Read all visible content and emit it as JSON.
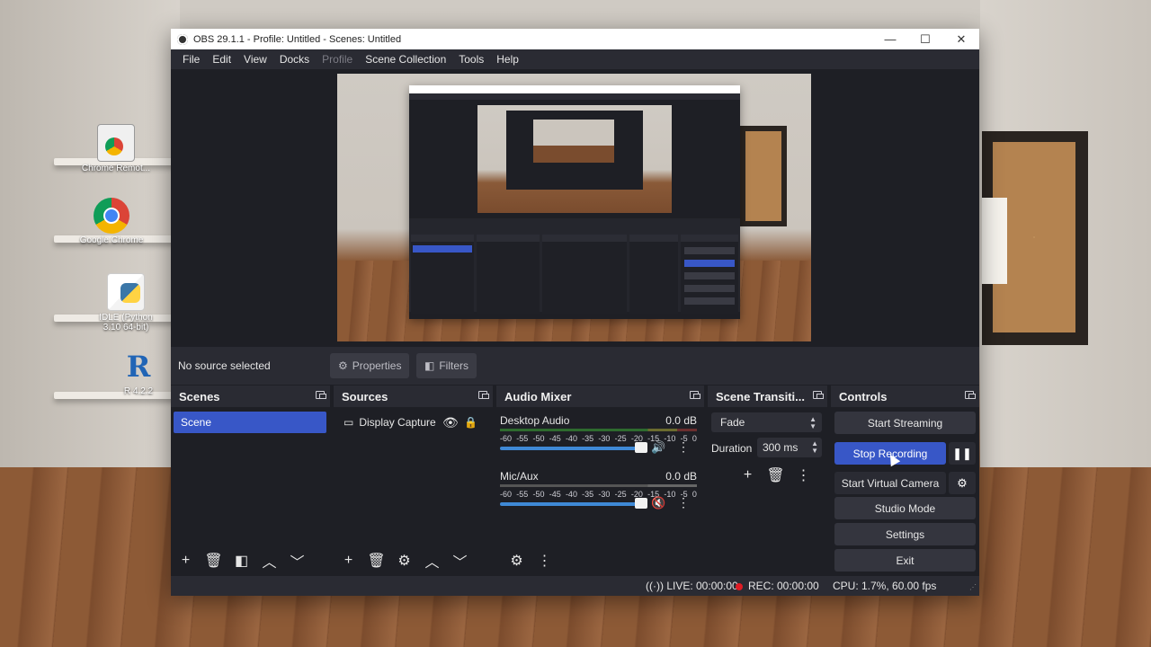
{
  "desktop": {
    "icons": [
      {
        "label": "Chrome Remot...",
        "icon": "chrome-remote-desktop-icon"
      },
      {
        "label": "Google Chrome",
        "icon": "chrome-icon"
      },
      {
        "label": "IDLE (Python 3.10 64-bit)",
        "icon": "python-idle-icon"
      },
      {
        "label": "R 4.2.2",
        "icon": "r-icon"
      }
    ]
  },
  "window": {
    "title": "OBS 29.1.1 - Profile: Untitled - Scenes: Untitled",
    "controls": {
      "minimize": "—",
      "maximize": "☐",
      "close": "✕"
    }
  },
  "menu": {
    "items": [
      "File",
      "Edit",
      "View",
      "Docks",
      "Profile",
      "Scene Collection",
      "Tools",
      "Help"
    ],
    "disabled": [
      "Profile"
    ]
  },
  "source_toolbar": {
    "status": "No source selected",
    "properties": "Properties",
    "filters": "Filters"
  },
  "docks": {
    "scenes": {
      "title": "Scenes",
      "items": [
        "Scene"
      ],
      "selected": "Scene"
    },
    "sources": {
      "title": "Sources",
      "items": [
        {
          "name": "Display Capture",
          "visible": true,
          "locked": false
        }
      ]
    },
    "audio_mixer": {
      "title": "Audio Mixer",
      "channels": [
        {
          "name": "Desktop Audio",
          "level": "0.0 dB",
          "muted": false
        },
        {
          "name": "Mic/Aux",
          "level": "0.0 dB",
          "muted": true
        }
      ],
      "scale": [
        "-60",
        "-55",
        "-50",
        "-45",
        "-40",
        "-35",
        "-30",
        "-25",
        "-20",
        "-15",
        "-10",
        "-5",
        "0"
      ]
    },
    "transitions": {
      "title": "Scene Transiti...",
      "selected": "Fade",
      "duration_label": "Duration",
      "duration_value": "300 ms"
    },
    "controls": {
      "title": "Controls",
      "start_streaming": "Start Streaming",
      "stop_recording": "Stop Recording",
      "start_virtual_camera": "Start Virtual Camera",
      "studio_mode": "Studio Mode",
      "settings": "Settings",
      "exit": "Exit"
    }
  },
  "status": {
    "live": "LIVE: 00:00:00",
    "rec": "REC: 00:00:00",
    "cpu": "CPU: 1.7%, 60.00 fps"
  },
  "colors": {
    "accent": "#3857c7",
    "dock_bg": "#1e1f25",
    "header_bg": "#2a2b33",
    "rec_red": "#e01b24"
  }
}
